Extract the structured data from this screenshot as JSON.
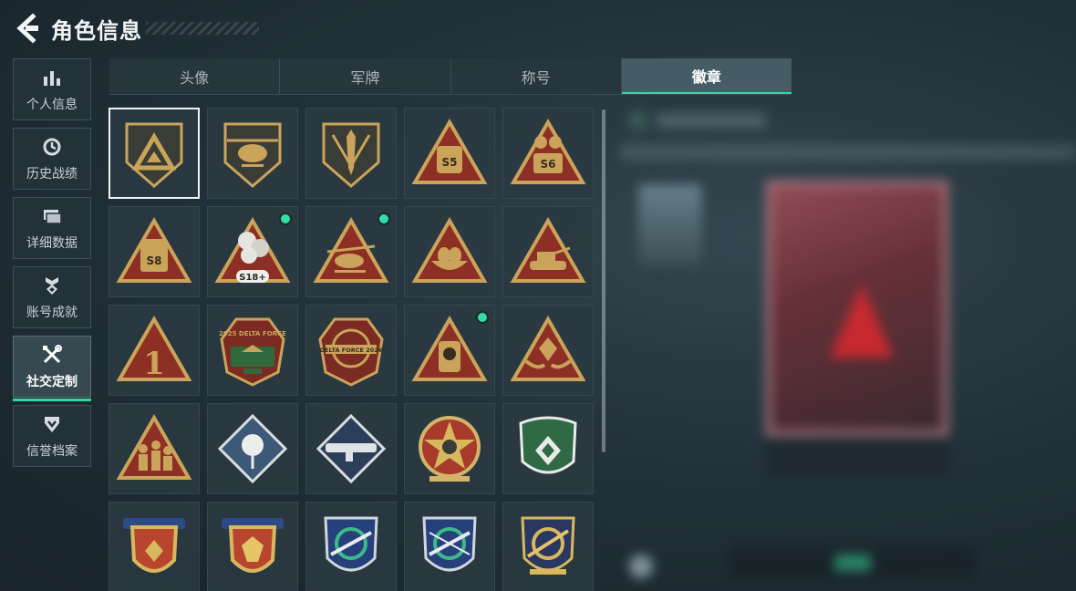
{
  "header": {
    "title": "角色信息"
  },
  "sidebar": {
    "items": [
      {
        "label": "个人信息",
        "icon": "bar-chart-icon"
      },
      {
        "label": "历史战绩",
        "icon": "clock-icon"
      },
      {
        "label": "详细数据",
        "icon": "folder-icon"
      },
      {
        "label": "账号成就",
        "icon": "medal-icon"
      },
      {
        "label": "社交定制",
        "icon": "tools-icon",
        "active": true
      },
      {
        "label": "信誉档案",
        "icon": "shield-icon"
      }
    ]
  },
  "tabs": [
    {
      "label": "头像"
    },
    {
      "label": "军牌"
    },
    {
      "label": "称号"
    },
    {
      "label": "徽章",
      "active": true
    }
  ],
  "badges": [
    {
      "icon": "triangle-shield-badge-icon",
      "selected": true
    },
    {
      "icon": "helicopter-shield-badge-icon"
    },
    {
      "icon": "dagger-shield-badge-icon"
    },
    {
      "icon": "season-s5-badge-icon",
      "text": "S5"
    },
    {
      "icon": "season-s6-badge-icon",
      "text": "S6"
    },
    {
      "icon": "season-s8-badge-icon",
      "text": "S8"
    },
    {
      "icon": "season-s18-badge-icon",
      "text": "S18+",
      "new": true
    },
    {
      "icon": "helicopter-triangle-badge-icon",
      "new": true
    },
    {
      "icon": "egg-nest-badge-icon"
    },
    {
      "icon": "tank-triangle-badge-icon"
    },
    {
      "icon": "number-one-badge-icon",
      "text": "1"
    },
    {
      "icon": "delta-force-2025-badge-icon",
      "text": "2025 DELTA FORCE"
    },
    {
      "icon": "delta-force-2026-badge-icon",
      "text": "DELTA FORCE 2026"
    },
    {
      "icon": "soldier-triangle-badge-icon",
      "new": true
    },
    {
      "icon": "hands-gem-badge-icon"
    },
    {
      "icon": "squad-triangle-badge-icon"
    },
    {
      "icon": "rose-diamond-badge-icon"
    },
    {
      "icon": "launcher-diamond-badge-icon"
    },
    {
      "icon": "star-emblem-badge-icon"
    },
    {
      "icon": "green-shield-badge-icon"
    },
    {
      "icon": "laurel-shield-red-badge-icon"
    },
    {
      "icon": "laurel-shield-gem-badge-icon"
    },
    {
      "icon": "crosshair-rifle-blue-badge-icon"
    },
    {
      "icon": "crosshair-rifle-blue2-badge-icon"
    },
    {
      "icon": "crosshair-gold-badge-icon"
    }
  ],
  "colors": {
    "accent": "#30d9a4",
    "badge_gold": "#c9a45a",
    "badge_red": "#8e2f25",
    "badge_dark": "#3a3d36"
  }
}
